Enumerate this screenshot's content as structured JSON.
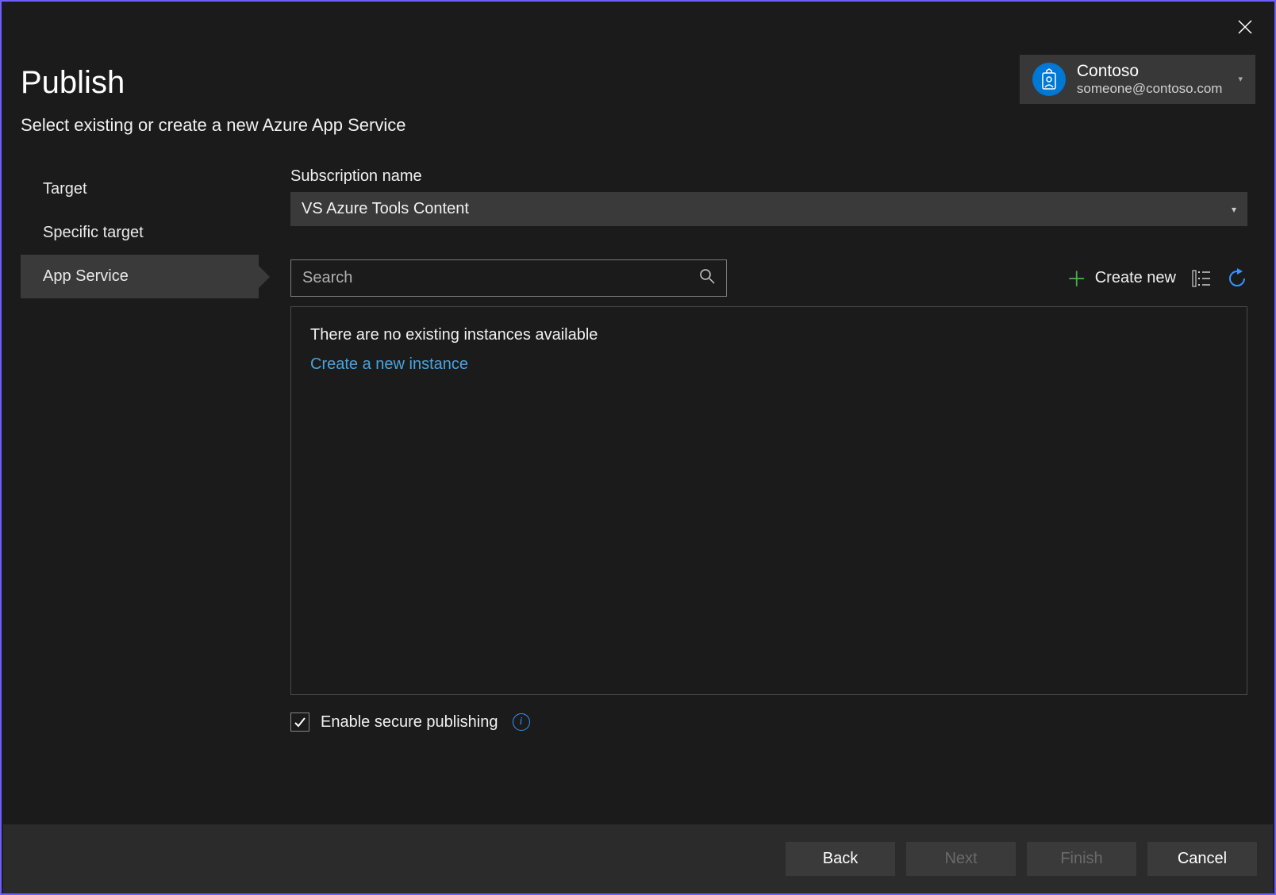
{
  "header": {
    "title": "Publish",
    "subtitle": "Select existing or create a new Azure App Service"
  },
  "account": {
    "name": "Contoso",
    "email": "someone@contoso.com"
  },
  "sidebar": {
    "items": [
      {
        "label": "Target"
      },
      {
        "label": "Specific target"
      },
      {
        "label": "App Service"
      }
    ]
  },
  "subscription": {
    "label": "Subscription name",
    "value": "VS Azure Tools Content"
  },
  "search": {
    "placeholder": "Search"
  },
  "toolbar": {
    "create_new": "Create new"
  },
  "instances": {
    "empty_message": "There are no existing instances available",
    "create_link": "Create a new instance"
  },
  "secure_publishing": {
    "label": "Enable secure publishing",
    "checked": true
  },
  "footer": {
    "back": "Back",
    "next": "Next",
    "finish": "Finish",
    "cancel": "Cancel"
  }
}
